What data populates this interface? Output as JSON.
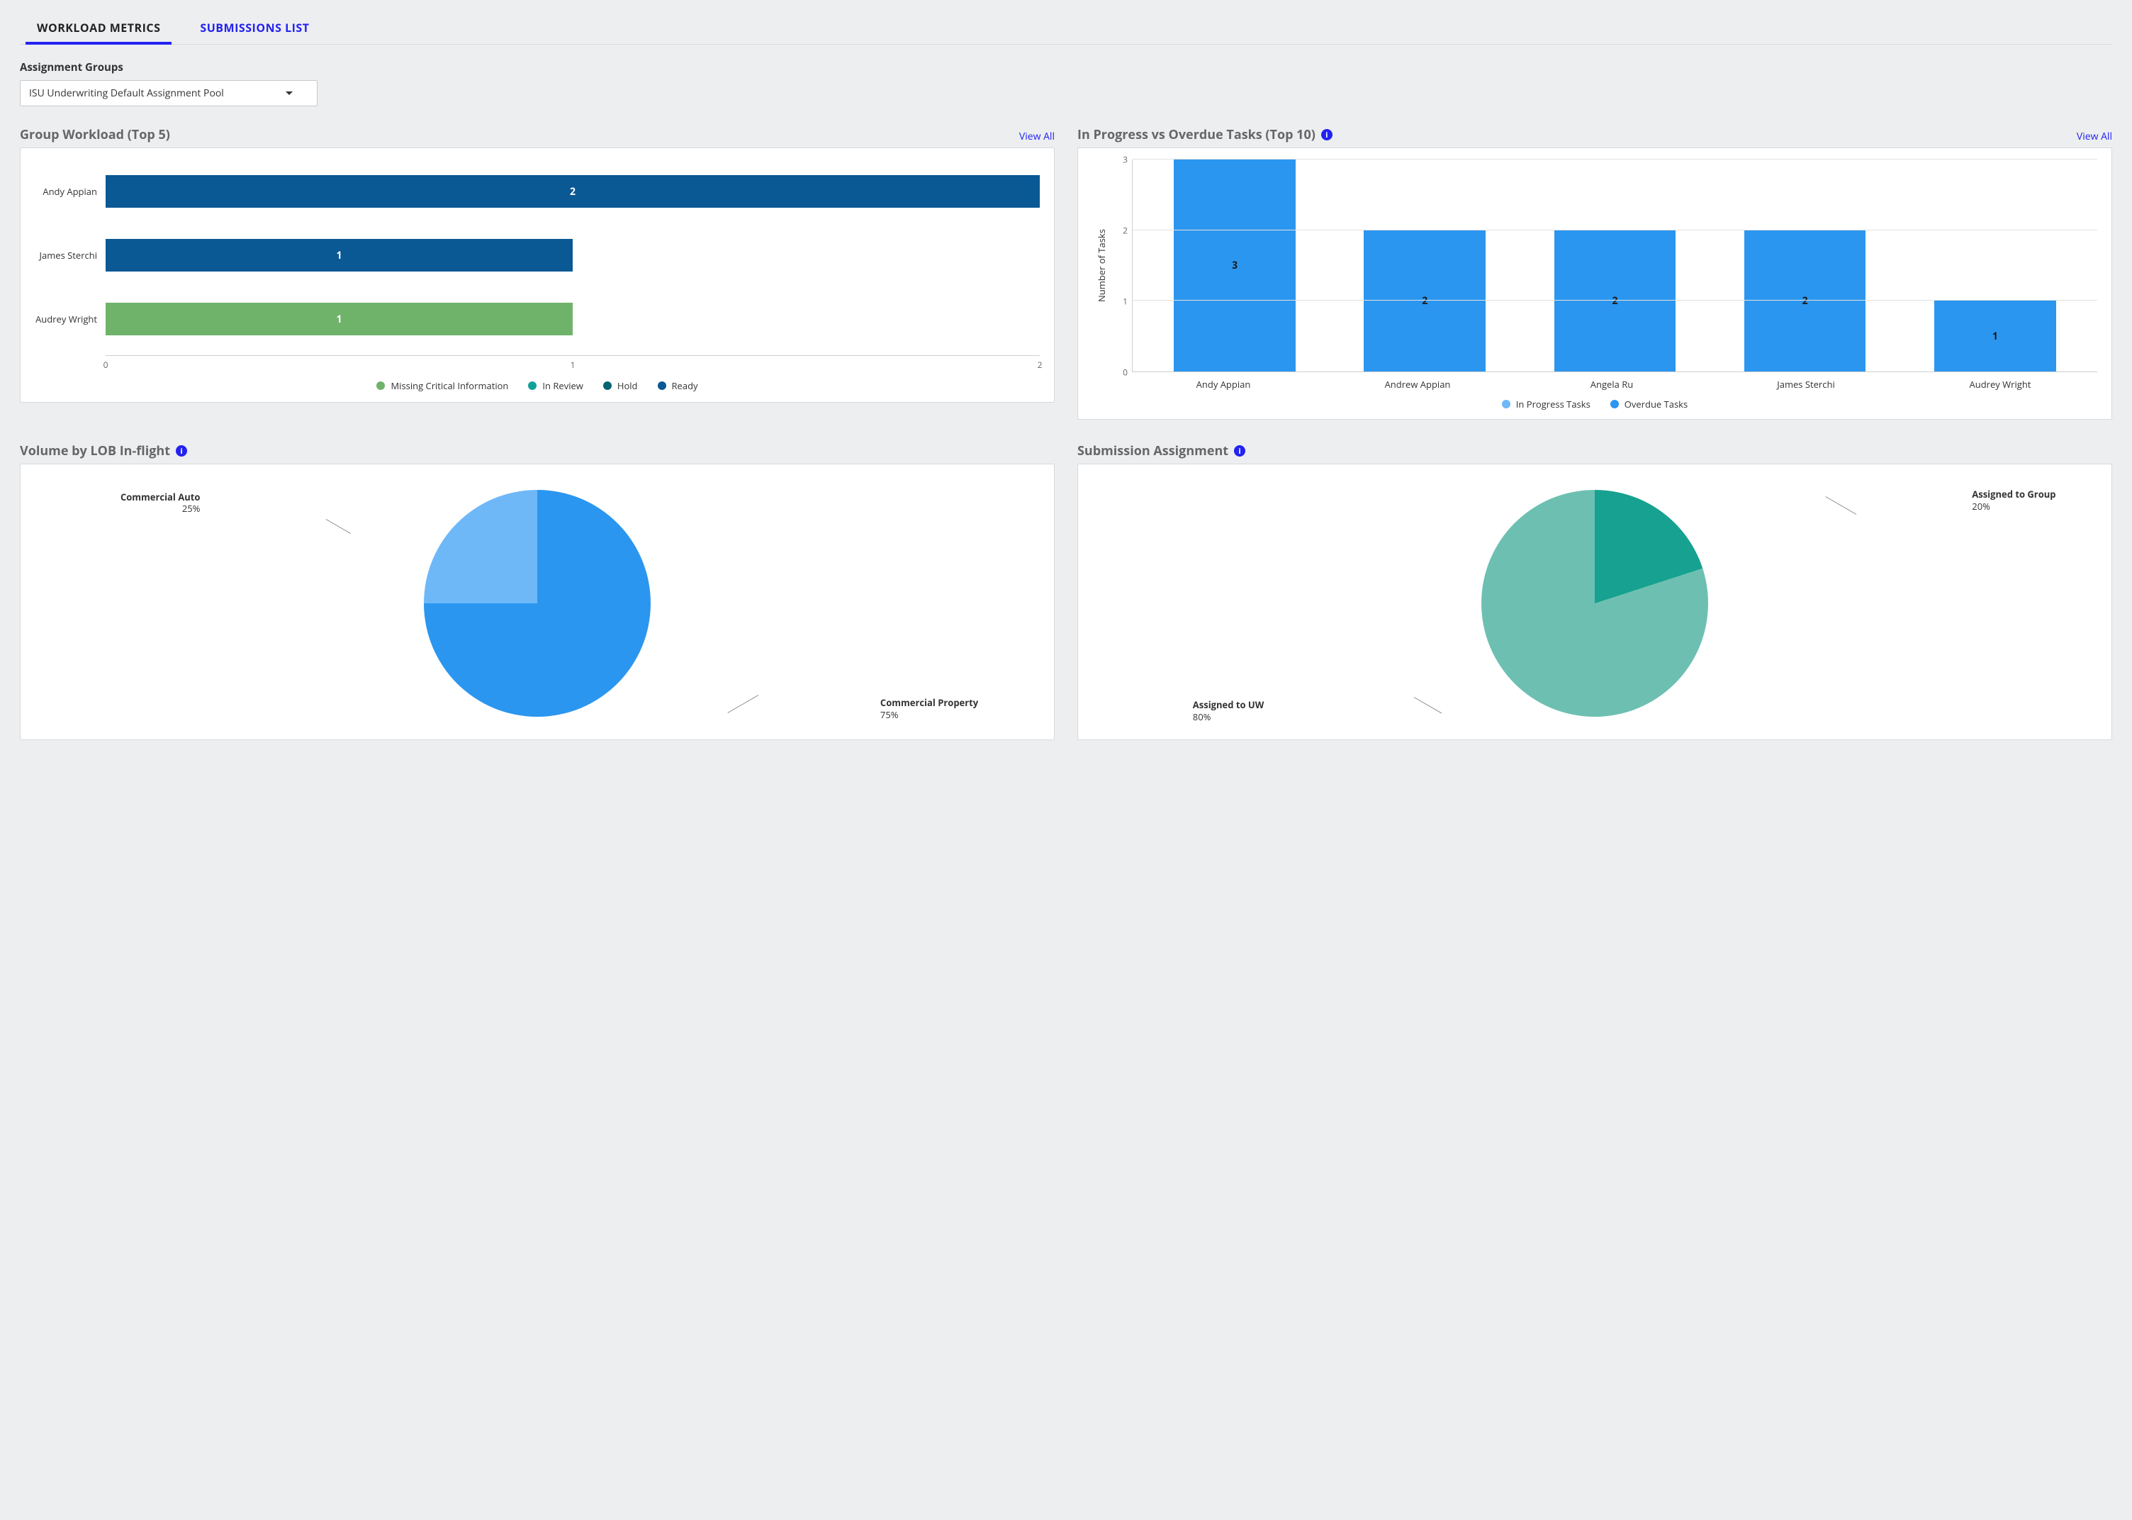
{
  "tabs": {
    "workload_metrics": "WORKLOAD METRICS",
    "submissions_list": "SUBMISSIONS LIST"
  },
  "assignment_groups": {
    "label": "Assignment Groups",
    "selected": "ISU Underwriting Default Assignment Pool"
  },
  "sections": {
    "group_workload": {
      "title": "Group Workload (Top 5)",
      "view_all": "View All"
    },
    "in_progress_vs_overdue": {
      "title": "In Progress vs Overdue Tasks (Top 10)",
      "view_all": "View All"
    },
    "volume_by_lob": {
      "title": "Volume by LOB In-flight"
    },
    "submission_assignment": {
      "title": "Submission Assignment"
    }
  },
  "chart_data": [
    {
      "id": "group_workload",
      "type": "bar",
      "orientation": "horizontal",
      "stacked": true,
      "categories": [
        "Andy Appian",
        "James Sterchi",
        "Audrey Wright"
      ],
      "series": [
        {
          "name": "Missing Critical Information",
          "color": "#6fb36a",
          "values": [
            0,
            0,
            1
          ]
        },
        {
          "name": "In Review",
          "color": "#12a19a",
          "values": [
            0,
            0,
            0
          ]
        },
        {
          "name": "Hold",
          "color": "#086472",
          "values": [
            0,
            0,
            0
          ]
        },
        {
          "name": "Ready",
          "color": "#0a5894",
          "values": [
            2,
            1,
            0
          ]
        }
      ],
      "xlim": [
        0,
        2
      ],
      "xticks": [
        0,
        1,
        2
      ],
      "xlabel": "",
      "ylabel": "",
      "legend_position": "bottom"
    },
    {
      "id": "in_progress_vs_overdue",
      "type": "bar",
      "orientation": "vertical",
      "stacked": false,
      "categories": [
        "Andy Appian",
        "Andrew Appian",
        "Angela Ru",
        "James Sterchi",
        "Audrey Wright"
      ],
      "series": [
        {
          "name": "In Progress Tasks",
          "color": "#6fb8f7",
          "values": [
            0,
            0,
            0,
            0,
            0
          ]
        },
        {
          "name": "Overdue Tasks",
          "color": "#2b96ef",
          "values": [
            3,
            2,
            2,
            2,
            1
          ]
        }
      ],
      "ylim": [
        0,
        3
      ],
      "yticks": [
        0,
        1,
        2,
        3
      ],
      "ylabel": "Number of Tasks",
      "xlabel": "",
      "legend_position": "bottom"
    },
    {
      "id": "volume_by_lob",
      "type": "pie",
      "slices": [
        {
          "name": "Commercial Property",
          "value": 75,
          "label": "Commercial Property 75%",
          "color": "#2b96ef"
        },
        {
          "name": "Commercial Auto",
          "value": 25,
          "label": "Commercial Auto 25%",
          "color": "#6fb8f7"
        }
      ]
    },
    {
      "id": "submission_assignment",
      "type": "pie",
      "slices": [
        {
          "name": "Assigned to UW",
          "value": 80,
          "label": "Assigned to UW 80%",
          "color": "#6dc0b1"
        },
        {
          "name": "Assigned to Group",
          "value": 20,
          "label": "Assigned to Group 20%",
          "color": "#16a190"
        }
      ]
    }
  ],
  "legend_labels": {
    "group_workload": {
      "missing": "Missing Critical Information",
      "in_review": "In Review",
      "hold": "Hold",
      "ready": "Ready"
    },
    "tasks": {
      "in_progress": "In Progress Tasks",
      "overdue": "Overdue Tasks",
      "ylabel": "Number of Tasks"
    }
  },
  "pie_labels": {
    "lob": {
      "commercial_property_name": "Commercial Property",
      "commercial_property_pct": "75%",
      "commercial_auto_name": "Commercial Auto",
      "commercial_auto_pct": "25%"
    },
    "assignment": {
      "uw_name": "Assigned to UW",
      "uw_pct": "80%",
      "group_name": "Assigned to Group",
      "group_pct": "20%"
    }
  }
}
